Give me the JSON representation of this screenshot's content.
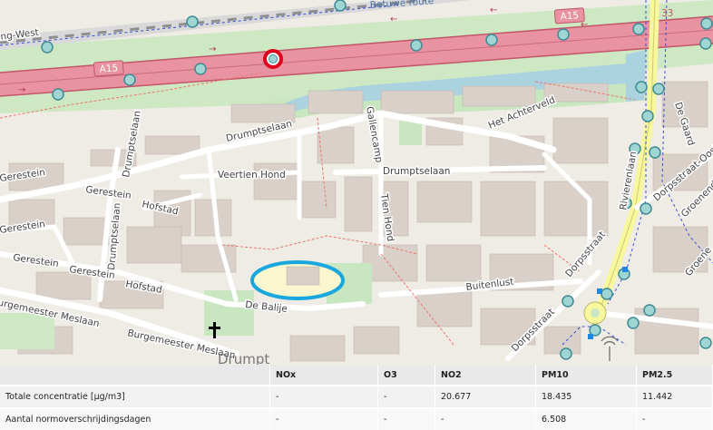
{
  "map": {
    "labels": {
      "motorway_top": "A15",
      "motorway_bottom": "A15",
      "railway": "Betuwe route",
      "street_west_edge": "ing-West",
      "drumptselaan_top": "Drumptselaan",
      "drumptselaan_left": "Drumptselaan",
      "drumptselaan_mid": "Drumptselaan",
      "drumptselaan_vert": "Drumptselaan",
      "veertien_hond": "Veertien Hond",
      "gerestein_1": "Gerestein",
      "gerestein_2": "Gerestein",
      "gerestein_3": "Gerestein",
      "gerestein_4": "Gerestein",
      "gerestein_5": "Gerestein",
      "hofstad_1": "Hofstad",
      "hofstad_2": "Hofstad",
      "gallencamp": "Gallencamp",
      "tien_hond": "Tien Hond",
      "het_achterveld": "Het Achterveld",
      "de_balije": "De Balije",
      "burgemeester_meslaan_1": "Burgemeester Meslaan",
      "burgemeester_meslaan_2": "Burgemeester Meslaan",
      "buitenlust": "Buitenlust",
      "dorpsstraat_1": "Dorpsstraat",
      "dorpsstraat_2": "Dorpsstraat",
      "rivierenlaan": "Rivierenlaan",
      "dorpsstraat_oost": "Dorpsstraat-Oost",
      "de_gaard": "De Gaard",
      "groenendaal_1": "Groenenda",
      "groenendaal_2": "Groene",
      "drumpt": "Drumpt",
      "exit_number": "33"
    },
    "colors": {
      "background": "#f2efe9",
      "motorway": "#e892a2",
      "water": "#aad3df",
      "park": "#c8e6c0",
      "highlight_ellipse": "#1aa7de",
      "marker": "#e0001b"
    }
  },
  "table": {
    "columns": [
      "",
      "NOx",
      "O3",
      "NO2",
      "PM10",
      "PM2.5"
    ],
    "rows": [
      {
        "label": "Totale concentratie [µg/m3]",
        "values": [
          "-",
          "-",
          "20.677",
          "18.435",
          "11.442"
        ]
      },
      {
        "label": "Aantal normoverschrijdingsdagen",
        "values": [
          "-",
          "-",
          "-",
          "6.508",
          "-"
        ]
      }
    ]
  }
}
